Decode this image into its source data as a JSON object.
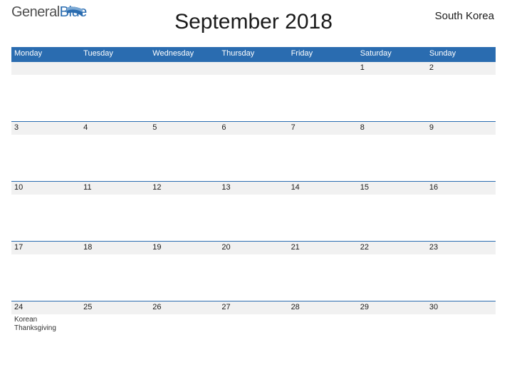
{
  "brand": {
    "part1": "General",
    "part2": "Blue"
  },
  "title": "September 2018",
  "region": "South Korea",
  "days_of_week": [
    "Monday",
    "Tuesday",
    "Wednesday",
    "Thursday",
    "Friday",
    "Saturday",
    "Sunday"
  ],
  "weeks": [
    [
      {
        "num": "",
        "event": ""
      },
      {
        "num": "",
        "event": ""
      },
      {
        "num": "",
        "event": ""
      },
      {
        "num": "",
        "event": ""
      },
      {
        "num": "",
        "event": ""
      },
      {
        "num": "1",
        "event": ""
      },
      {
        "num": "2",
        "event": ""
      }
    ],
    [
      {
        "num": "3",
        "event": ""
      },
      {
        "num": "4",
        "event": ""
      },
      {
        "num": "5",
        "event": ""
      },
      {
        "num": "6",
        "event": ""
      },
      {
        "num": "7",
        "event": ""
      },
      {
        "num": "8",
        "event": ""
      },
      {
        "num": "9",
        "event": ""
      }
    ],
    [
      {
        "num": "10",
        "event": ""
      },
      {
        "num": "11",
        "event": ""
      },
      {
        "num": "12",
        "event": ""
      },
      {
        "num": "13",
        "event": ""
      },
      {
        "num": "14",
        "event": ""
      },
      {
        "num": "15",
        "event": ""
      },
      {
        "num": "16",
        "event": ""
      }
    ],
    [
      {
        "num": "17",
        "event": ""
      },
      {
        "num": "18",
        "event": ""
      },
      {
        "num": "19",
        "event": ""
      },
      {
        "num": "20",
        "event": ""
      },
      {
        "num": "21",
        "event": ""
      },
      {
        "num": "22",
        "event": ""
      },
      {
        "num": "23",
        "event": ""
      }
    ],
    [
      {
        "num": "24",
        "event": "Korean Thanksgiving"
      },
      {
        "num": "25",
        "event": ""
      },
      {
        "num": "26",
        "event": ""
      },
      {
        "num": "27",
        "event": ""
      },
      {
        "num": "28",
        "event": ""
      },
      {
        "num": "29",
        "event": ""
      },
      {
        "num": "30",
        "event": ""
      }
    ]
  ]
}
